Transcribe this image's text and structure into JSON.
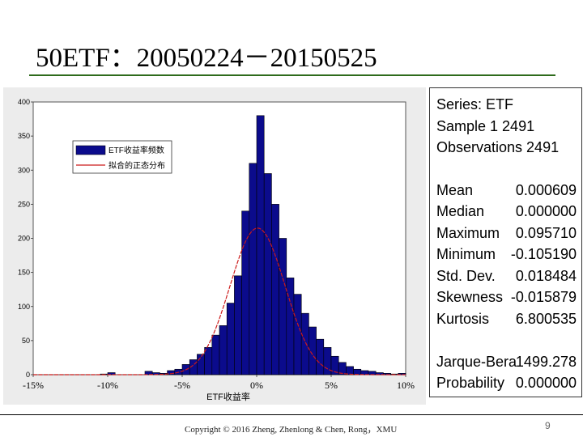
{
  "slide": {
    "title": "50ETF：20050224－20150525",
    "footer": "Copyright © 2016 Zheng, Zhenlong & Chen, Rong，XMU",
    "page_number": "9"
  },
  "chart_data": {
    "type": "bar",
    "title": "",
    "xlabel": "ETF收益率",
    "ylabel": "",
    "ylim": [
      0,
      400
    ],
    "xlim": [
      -0.15,
      0.1
    ],
    "y_ticks": [
      "0",
      "50",
      "100",
      "150",
      "200",
      "250",
      "300",
      "350",
      "400"
    ],
    "x_ticks": [
      {
        "value": -0.15,
        "label": "-15%"
      },
      {
        "value": -0.1,
        "label": "-10%"
      },
      {
        "value": -0.05,
        "label": "-5%"
      },
      {
        "value": 0.0,
        "label": "0%"
      },
      {
        "value": 0.05,
        "label": "5%"
      },
      {
        "value": 0.1,
        "label": "10%"
      }
    ],
    "bin_width": 0.005,
    "bin_starts": [
      -0.105,
      -0.1,
      -0.075,
      -0.07,
      -0.065,
      -0.06,
      -0.055,
      -0.05,
      -0.045,
      -0.04,
      -0.035,
      -0.03,
      -0.025,
      -0.02,
      -0.015,
      -0.01,
      -0.005,
      0.0,
      0.005,
      0.01,
      0.015,
      0.02,
      0.025,
      0.03,
      0.035,
      0.04,
      0.045,
      0.05,
      0.055,
      0.06,
      0.065,
      0.07,
      0.075,
      0.08,
      0.085,
      0.09,
      0.095
    ],
    "counts": [
      1,
      3,
      5,
      3,
      2,
      6,
      8,
      15,
      22,
      30,
      40,
      58,
      72,
      105,
      145,
      240,
      310,
      380,
      295,
      250,
      200,
      142,
      118,
      90,
      70,
      52,
      40,
      27,
      18,
      12,
      8,
      6,
      5,
      3,
      2,
      1,
      2
    ],
    "series": [
      {
        "name": "ETF收益率频数",
        "color": "#0b0b8c"
      },
      {
        "name": "拟合的正态分布",
        "color": "#cc1a1a",
        "mean": 0.000609,
        "std": 0.018484,
        "peak": 215
      }
    ],
    "legend_position": "top-left",
    "grid": false
  },
  "stats": {
    "header": [
      "Series: ETF",
      "Sample 1 2491",
      "Observations 2491"
    ],
    "rows": [
      {
        "label": "Mean",
        "value": "0.000609"
      },
      {
        "label": "Median",
        "value": "0.000000"
      },
      {
        "label": "Maximum",
        "value": "0.095710"
      },
      {
        "label": "Minimum",
        "value": "-0.105190"
      },
      {
        "label": "Std. Dev.",
        "value": "0.018484"
      },
      {
        "label": "Skewness",
        "value": "-0.015879"
      },
      {
        "label": "Kurtosis",
        "value": "6.800535"
      },
      {
        "label": "Jarque-Bera",
        "value": "1499.278"
      },
      {
        "label": "Probability",
        "value": "0.000000"
      }
    ]
  }
}
